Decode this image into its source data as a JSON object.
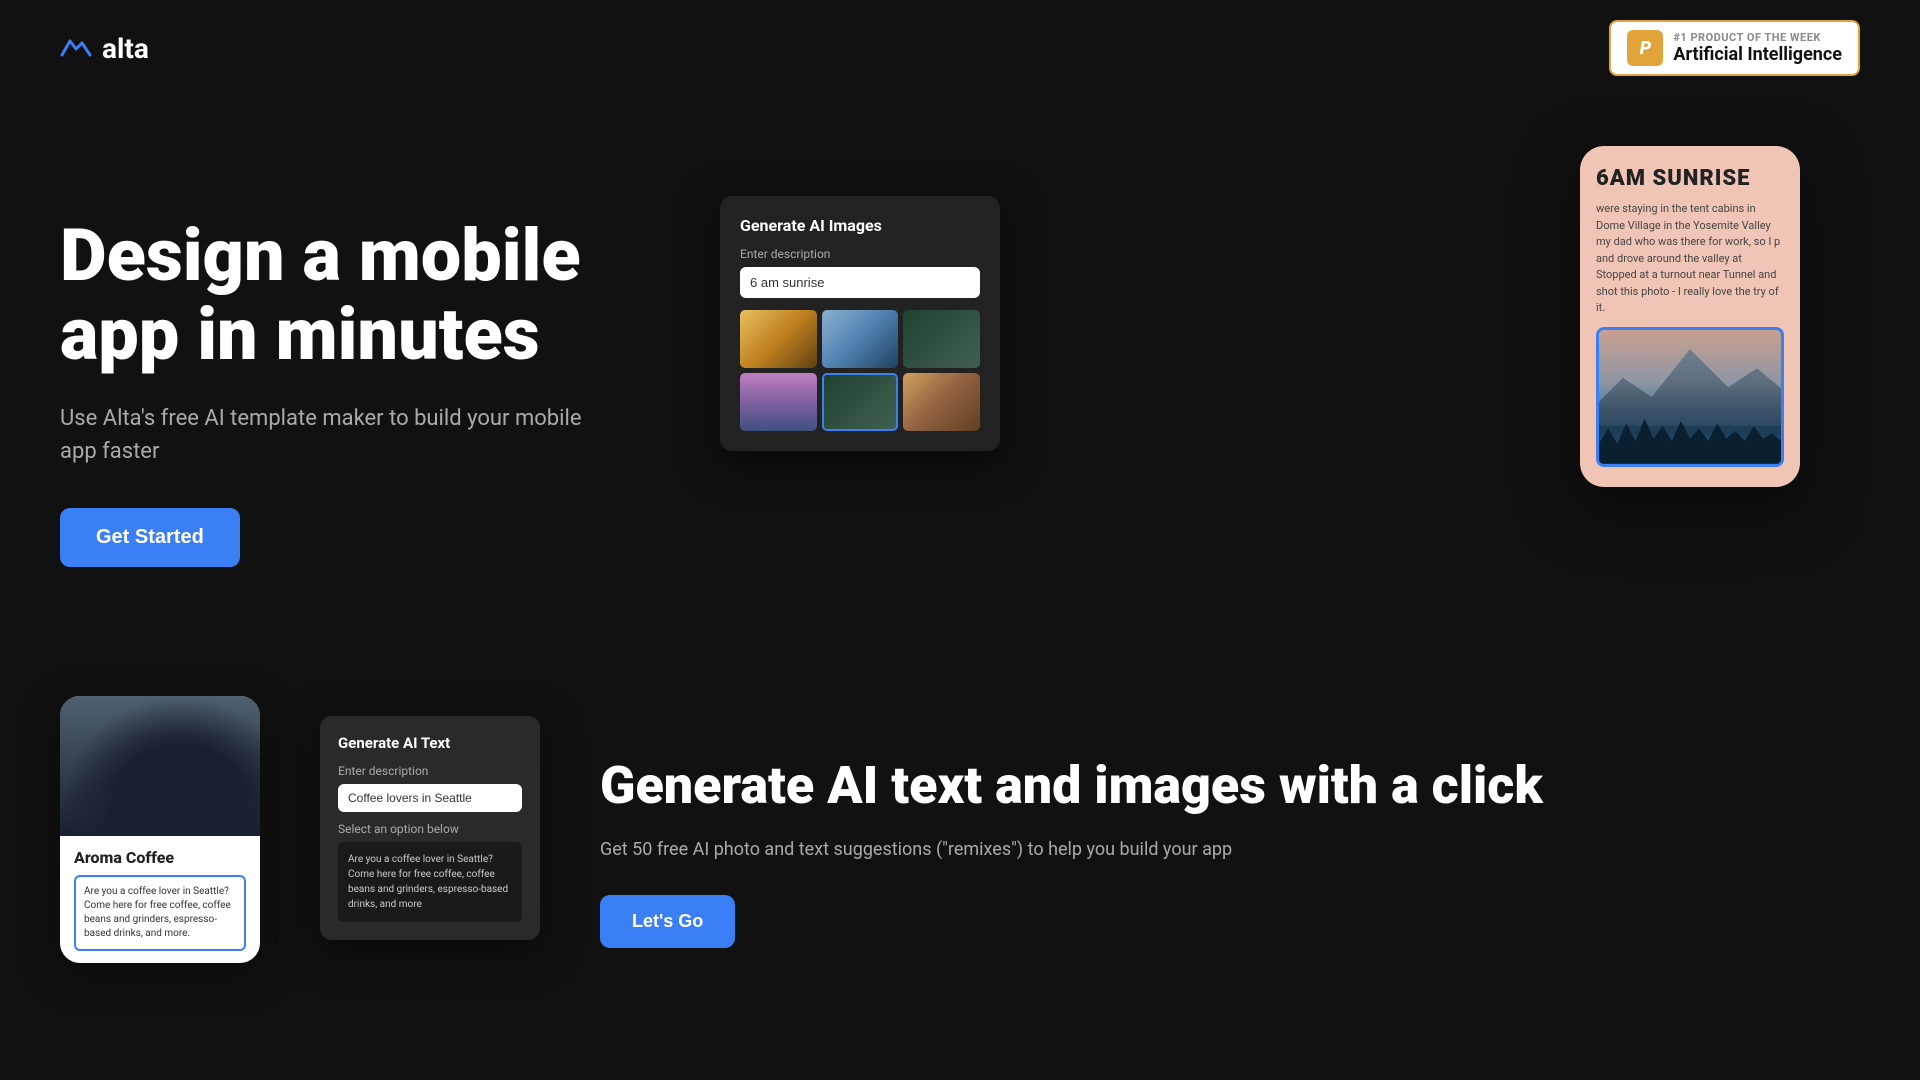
{
  "nav": {
    "logo_text": "alta",
    "product_badge": {
      "rank": "#1",
      "sub_label": "Product of the Week",
      "title": "Artificial Intelligence"
    }
  },
  "hero": {
    "heading": "Design a mobile app in minutes",
    "subtext": "Use Alta's free AI template maker to build your mobile app faster",
    "cta_label": "Get Started"
  },
  "ai_image_dialog": {
    "title": "Generate AI Images",
    "description_label": "Enter description",
    "description_value": "6 am sunrise"
  },
  "phone_mockup": {
    "title": "6AM SUNRISE",
    "text": "were staying in the tent cabins in Dome Village in the Yosemite Valley my dad who was there for work, so I p and drove around the valley at Stopped at a turnout near Tunnel and shot this photo - I really love the try of it."
  },
  "second_section": {
    "coffee_card": {
      "title": "Aroma Coffee",
      "text": "Are you a coffee lover in Seattle? Come here for free coffee, coffee beans and grinders, espresso-based drinks, and more."
    },
    "ai_text_dialog": {
      "title": "Generate AI Text",
      "description_label": "Enter description",
      "description_value": "Coffee lovers in Seattle",
      "select_label": "Select an option below",
      "output_text": "Are you a coffee lover in Seattle? Come here for free coffee, coffee beans and grinders, espresso-based drinks, and more"
    },
    "heading": "Generate AI text and images with a click",
    "subtext": "Get 50 free AI photo and text suggestions (\"remixes\") to help you build your app",
    "cta_label": "Let's Go"
  }
}
